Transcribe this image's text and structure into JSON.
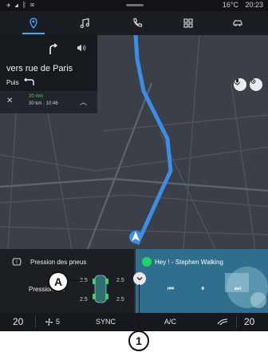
{
  "status": {
    "time": "20:23",
    "temperature": "16°C",
    "left_icons": "✈ ◢ ᛒ ✉"
  },
  "appbar": {
    "tabs": [
      {
        "icon": "navigation-pin-icon"
      },
      {
        "icon": "music-note-icon"
      },
      {
        "icon": "phone-icon"
      },
      {
        "icon": "apps-grid-icon"
      },
      {
        "icon": "car-icon"
      }
    ],
    "active_tab": 0,
    "accent": "#4aa3ff"
  },
  "navigation": {
    "street": "vers rue de Paris",
    "then_label": "Puis",
    "eta_time": "20 min",
    "eta_detail": "30 km · 10:46",
    "close_symbol": "✕",
    "chevron_symbol": "︿"
  },
  "tyres": {
    "title": "Pression des pneus",
    "status": "Pression OK",
    "front_left": "2.5",
    "front_right": "2.5",
    "rear_left": "2.5",
    "rear_right": "2.5"
  },
  "media": {
    "title": "Hey ! - Stephen Walking",
    "prev": "⏮",
    "play": "⏸",
    "next": "⏭"
  },
  "climate": {
    "left_temp": "20",
    "fan": "5",
    "sync": "SYNC",
    "ac": "A/C",
    "right_temp": "20"
  },
  "callouts": {
    "a": "A",
    "one": "1"
  }
}
